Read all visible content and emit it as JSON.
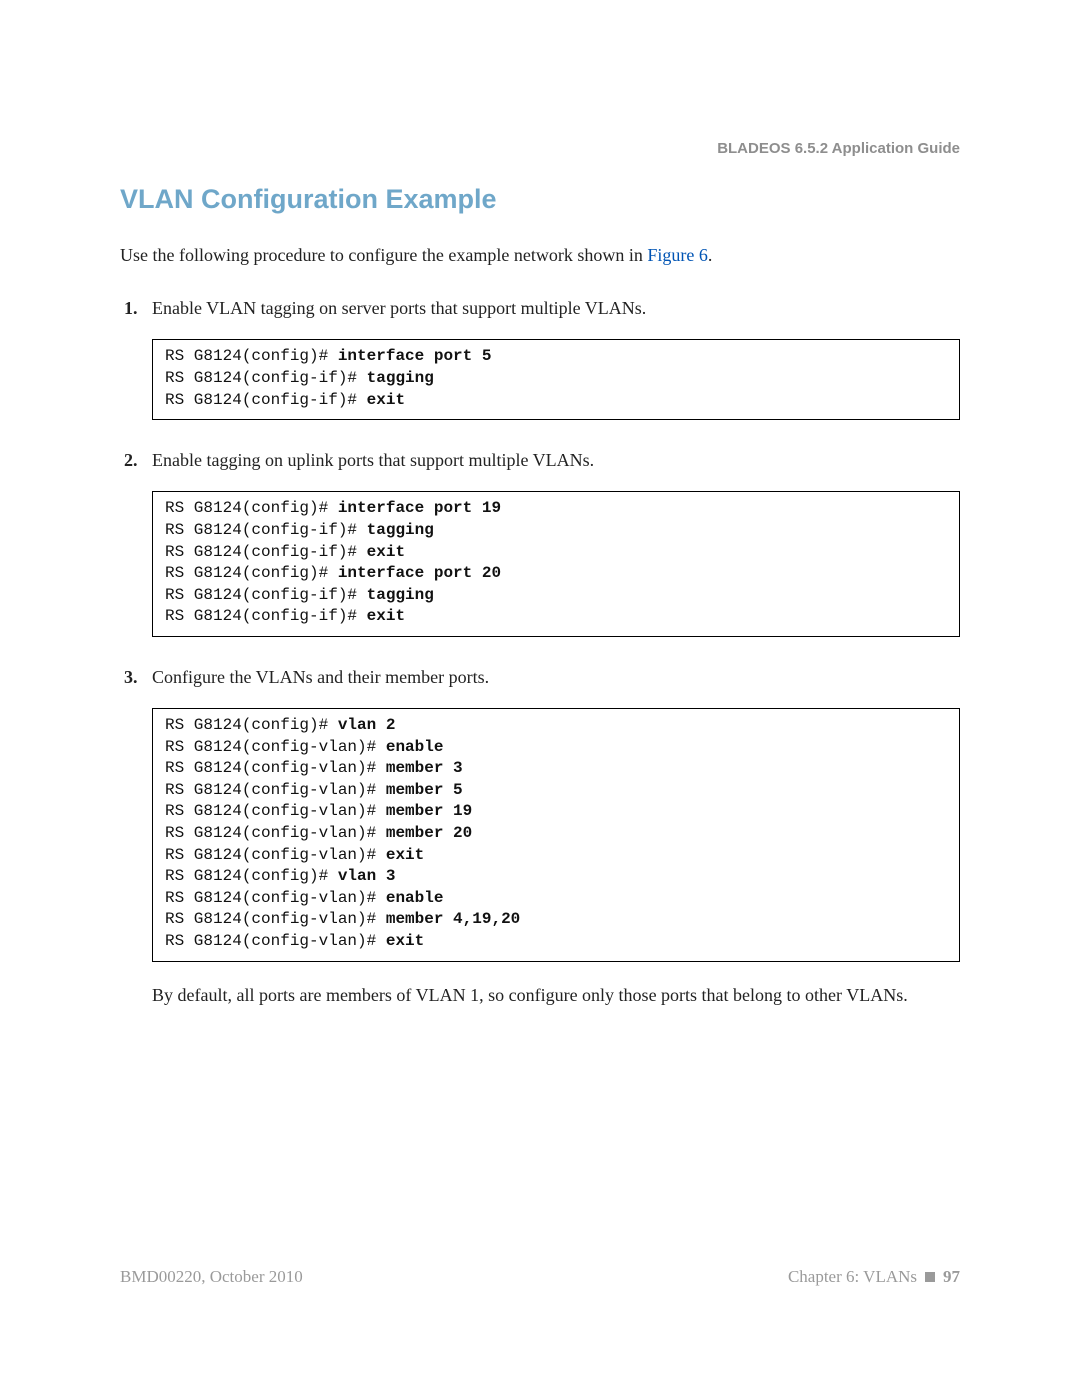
{
  "header": {
    "right": "BLADEOS 6.5.2 Application Guide"
  },
  "title": "VLAN Configuration Example",
  "intro": {
    "pre": "Use the following procedure to configure the example network shown in ",
    "link": "Figure 6",
    "post": "."
  },
  "steps": [
    {
      "num": "1.",
      "text": "Enable VLAN tagging on server ports that support multiple VLANs.",
      "code": [
        {
          "plain": "RS G8124(config)# ",
          "bold": "interface port 5"
        },
        {
          "plain": "RS G8124(config-if)# ",
          "bold": "tagging"
        },
        {
          "plain": "RS G8124(config-if)# ",
          "bold": "exit"
        }
      ]
    },
    {
      "num": "2.",
      "text": "Enable tagging on uplink ports that support multiple VLANs.",
      "code": [
        {
          "plain": "RS G8124(config)# ",
          "bold": "interface port 19"
        },
        {
          "plain": "RS G8124(config-if)# ",
          "bold": "tagging"
        },
        {
          "plain": "RS G8124(config-if)# ",
          "bold": "exit"
        },
        {
          "plain": "RS G8124(config)# ",
          "bold": "interface port 20"
        },
        {
          "plain": "RS G8124(config-if)# ",
          "bold": "tagging"
        },
        {
          "plain": "RS G8124(config-if)# ",
          "bold": "exit"
        }
      ]
    },
    {
      "num": "3.",
      "text": "Configure the VLANs and their member ports.",
      "code": [
        {
          "plain": "RS G8124(config)# ",
          "bold": "vlan 2"
        },
        {
          "plain": "RS G8124(config-vlan)# ",
          "bold": "enable"
        },
        {
          "plain": "RS G8124(config-vlan)# ",
          "bold": "member 3"
        },
        {
          "plain": "RS G8124(config-vlan)# ",
          "bold": "member 5"
        },
        {
          "plain": "RS G8124(config-vlan)# ",
          "bold": "member 19"
        },
        {
          "plain": "RS G8124(config-vlan)# ",
          "bold": "member 20"
        },
        {
          "plain": "RS G8124(config-vlan)# ",
          "bold": "exit"
        },
        {
          "plain": "RS G8124(config)# ",
          "bold": "vlan 3"
        },
        {
          "plain": "RS G8124(config-vlan)# ",
          "bold": "enable"
        },
        {
          "plain": "RS G8124(config-vlan)# ",
          "bold": "member 4,19,20"
        },
        {
          "plain": "RS G8124(config-vlan)# ",
          "bold": "exit"
        }
      ],
      "note": "By default, all ports are members of VLAN 1, so configure only those ports that belong to other VLANs."
    }
  ],
  "footer": {
    "left": "BMD00220, October 2010",
    "rightChapter": "Chapter 6: VLANs",
    "page": "97"
  }
}
